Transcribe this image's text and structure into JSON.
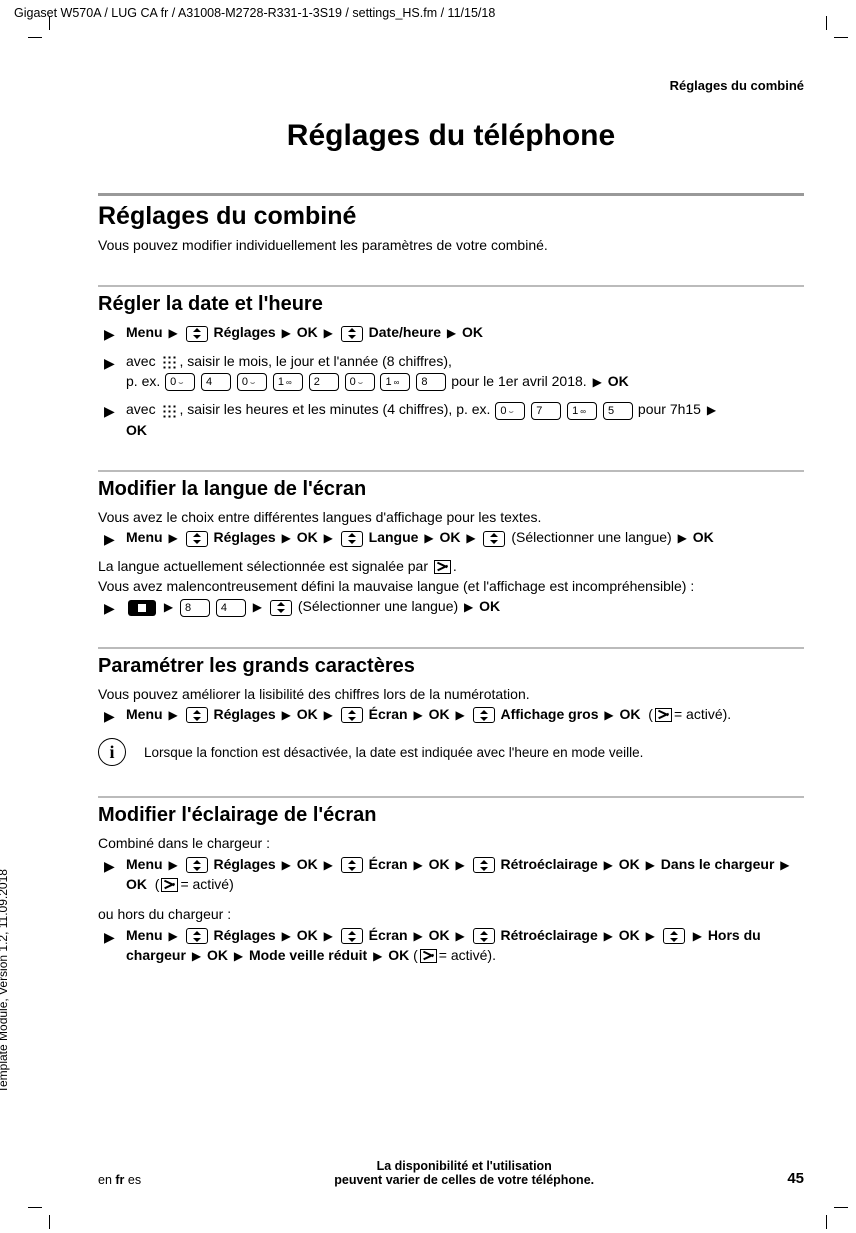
{
  "header_path": "Gigaset W570A / LUG CA fr / A31008-M2728-R331-1-3S19 / settings_HS.fm / 11/15/18",
  "side_text": "Template Module, Version 1.2, 11.09.2018",
  "top_right": "Réglages du combiné",
  "title": "Réglages du téléphone",
  "section_combine": {
    "h2": "Réglages du combiné",
    "intro": "Vous pouvez modifier individuellement les paramètres de votre combiné."
  },
  "section_date": {
    "h3": "Régler la date et l'heure",
    "step1": {
      "menu": "Menu",
      "reglages": "Réglages",
      "ok1": "OK",
      "dateheure": "Date/heure",
      "ok2": "OK"
    },
    "step2": {
      "pre": "avec",
      "mid": ", saisir le mois, le jour et l'année (8 chiffres),",
      "pex": "p. ex.",
      "post": "pour le 1er avril 2018.",
      "ok": "OK"
    },
    "step3": {
      "pre": "avec",
      "mid": ", saisir les heures et les minutes (4 chiffres), p. ex.",
      "post": "pour 7h15",
      "ok": "OK"
    }
  },
  "section_langue": {
    "h3": "Modifier la langue de l'écran",
    "intro": "Vous avez le choix entre différentes langues d'affichage pour les textes.",
    "step1": {
      "menu": "Menu",
      "reglages": "Réglages",
      "ok1": "OK",
      "langue": "Langue",
      "ok2": "OK",
      "select": "(Sélectionner une langue)",
      "ok3": "OK"
    },
    "line2a": "La langue actuellement sélectionnée est signalée par",
    "line2b": ".",
    "line3": "Vous avez malencontreusement défini la mauvaise langue (et l'affichage est incompréhensible) :",
    "step2": {
      "select": "(Sélectionner une langue)",
      "ok": "OK"
    }
  },
  "section_grands": {
    "h3": "Paramétrer les grands caractères",
    "intro": "Vous pouvez améliorer la lisibilité des chiffres lors de la numérotation.",
    "step1": {
      "menu": "Menu",
      "reglages": "Réglages",
      "ok1": "OK",
      "ecran": "Écran",
      "ok2": "OK",
      "affichage": "Affichage gros",
      "ok3": "OK",
      "active": "= activé)."
    },
    "info": "Lorsque la fonction est désactivée, la date est indiquée avec l'heure en mode veille."
  },
  "section_eclairage": {
    "h3": "Modifier l'éclairage de l'écran",
    "intro1": "Combiné dans le chargeur :",
    "step1": {
      "menu": "Menu",
      "reglages": "Réglages",
      "ok1": "OK",
      "ecran": "Écran",
      "ok2": "OK",
      "retro": "Rétroéclairage",
      "ok3": "OK",
      "dans": "Dans le chargeur",
      "ok4": "OK",
      "active": "= activé)"
    },
    "intro2": "ou hors du chargeur :",
    "step2": {
      "menu": "Menu",
      "reglages": "Réglages",
      "ok1": "OK",
      "ecran": "Écran",
      "ok2": "OK",
      "retro": "Rétroéclairage",
      "ok3": "OK",
      "hors": "Hors du chargeur",
      "ok4": "OK",
      "mode": "Mode veille réduit",
      "ok5": "OK",
      "active": "= activé)."
    }
  },
  "footer": {
    "left_en": "en",
    "left_fr": "fr",
    "left_es": "es",
    "center1": "La disponibilité et l'utilisation",
    "center2": "peuvent varier de celles de votre téléphone.",
    "right": "45"
  },
  "keys": {
    "d0": "0",
    "d0sub": "⌣",
    "d1": "1",
    "d1sub": "∞",
    "d2": "2",
    "d4": "4",
    "d5": "5",
    "d7": "7",
    "d8": "8"
  }
}
